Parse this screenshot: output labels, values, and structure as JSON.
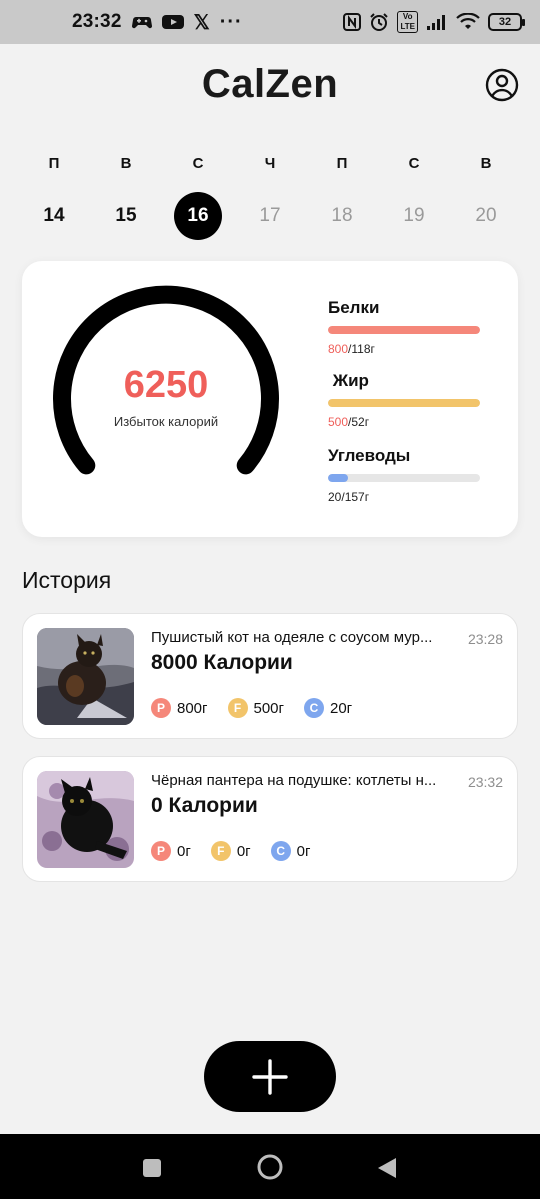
{
  "status_bar": {
    "time": "23:32",
    "icons_left": [
      "game-controller-icon",
      "youtube-icon",
      "x-icon",
      "more-dots-icon"
    ],
    "more_label": "···",
    "x_label": "𝕏",
    "volte_label": "Vo\nLTE",
    "battery_level": "32"
  },
  "header": {
    "title": "CalZen"
  },
  "week": {
    "days": [
      {
        "dow": "П",
        "num": "14",
        "state": "past"
      },
      {
        "dow": "В",
        "num": "15",
        "state": "past"
      },
      {
        "dow": "С",
        "num": "16",
        "state": "selected"
      },
      {
        "dow": "Ч",
        "num": "17",
        "state": "future"
      },
      {
        "dow": "П",
        "num": "18",
        "state": "future"
      },
      {
        "dow": "С",
        "num": "19",
        "state": "future"
      },
      {
        "dow": "В",
        "num": "20",
        "state": "future"
      }
    ]
  },
  "summary": {
    "value": "6250",
    "label": "Избыток калорий",
    "macros": [
      {
        "name": "Белки",
        "current": "800",
        "goal": "/118г",
        "fill": 1.0,
        "color": "#f5877a",
        "over": true
      },
      {
        "name": " Жир",
        "current": "500",
        "goal": "/52г",
        "fill": 1.0,
        "color": "#f2c46a",
        "over": true
      },
      {
        "name": "Углеводы",
        "current": "20",
        "goal": "/157г",
        "fill": 0.13,
        "color": "#7ea6ee",
        "over": false
      }
    ]
  },
  "history": {
    "title": "История",
    "entries": [
      {
        "name": "Пушистый кот на одеяле с соусом мур...",
        "time": "23:28",
        "calories": "8000 Калории",
        "protein": "800г",
        "fat": "500г",
        "carbs": "20г"
      },
      {
        "name": "Чёрная пантера на подушке: котлеты н...",
        "time": "23:32",
        "calories": "0 Калории",
        "protein": "0г",
        "fat": "0г",
        "carbs": "0г"
      }
    ]
  },
  "badges": {
    "protein": "P",
    "fat": "F",
    "carbs": "C"
  },
  "colors": {
    "accent_red": "#ef5f5a",
    "protein": "#f5877a",
    "fat": "#f2c46a",
    "carbs": "#7ea6ee"
  }
}
